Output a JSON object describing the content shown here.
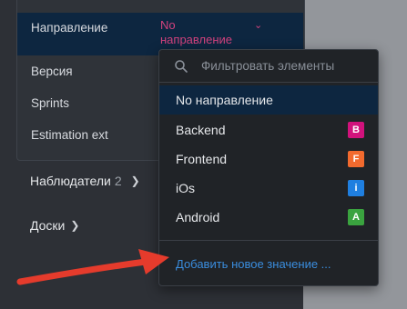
{
  "fields": [
    {
      "label": "Направление",
      "value": "No направление",
      "active": true
    },
    {
      "label": "Версия"
    },
    {
      "label": "Sprints"
    },
    {
      "label": "Estimation ext"
    }
  ],
  "sidebar": {
    "watchers": {
      "label": "Наблюдатели",
      "count": "2"
    },
    "boards": {
      "label": "Доски"
    }
  },
  "dropdown": {
    "filter_placeholder": "Фильтровать элементы",
    "options": [
      {
        "label": "No направление",
        "selected": true
      },
      {
        "label": "Backend",
        "badge": "B",
        "color": "#d1127c"
      },
      {
        "label": "Frontend",
        "badge": "F",
        "color": "#f26a2e"
      },
      {
        "label": "iOs",
        "badge": "i",
        "color": "#1f7fe0"
      },
      {
        "label": "Android",
        "badge": "A",
        "color": "#3aa33f"
      }
    ],
    "add_label": "Добавить новое значение ..."
  },
  "colors": {
    "accent_pink": "#d2427d",
    "link_blue": "#3a8dde",
    "selected_bg": "#0d2640",
    "annotation_arrow": "#e53b2c"
  }
}
